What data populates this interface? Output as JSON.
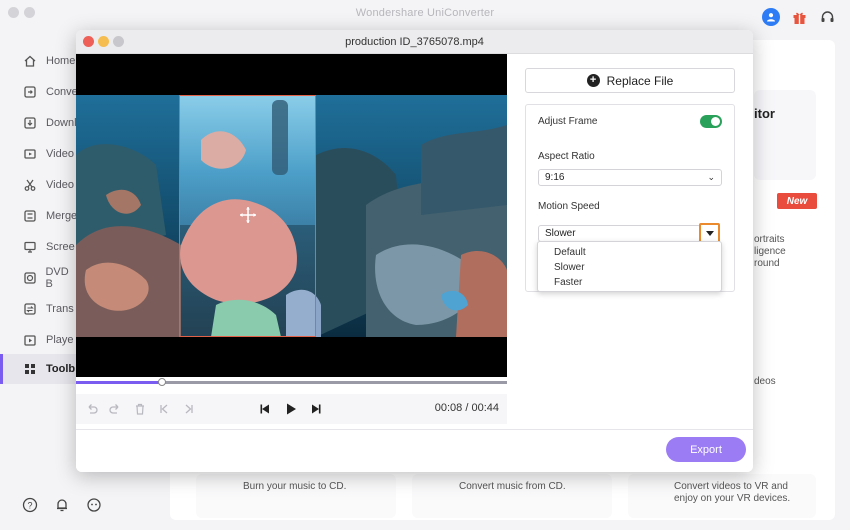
{
  "app": {
    "title": "Wondershare UniConverter"
  },
  "sidebar": {
    "items": [
      {
        "label": "Home",
        "icon": "home-icon"
      },
      {
        "label": "Conve",
        "icon": "convert-icon"
      },
      {
        "label": "Downl",
        "icon": "download-icon"
      },
      {
        "label": "Video",
        "icon": "video-compress-icon"
      },
      {
        "label": "Video",
        "icon": "scissors-icon"
      },
      {
        "label": "Merge",
        "icon": "merge-icon"
      },
      {
        "label": "Scree",
        "icon": "screen-record-icon"
      },
      {
        "label": "DVD B",
        "icon": "dvd-icon"
      },
      {
        "label": "Trans",
        "icon": "transfer-icon"
      },
      {
        "label": "Playe",
        "icon": "player-icon"
      },
      {
        "label": "Toolb",
        "icon": "toolbox-icon"
      }
    ],
    "active_index": 10
  },
  "background": {
    "itor_text": "itor",
    "new_badge": "New",
    "ai_portrait_text": "ortraits\nligence\nround",
    "videos_text": "deos",
    "burn_cd_text": "Burn your music to CD.",
    "cd_convert_text": "Convert music from CD.",
    "vr_text": "Convert videos to VR and\nenjoy on your VR devices."
  },
  "dialog": {
    "title": "production ID_3765078.mp4",
    "time_current": "00:08",
    "time_separator": "/",
    "time_total": "00:44",
    "progress_fraction": 0.2,
    "replace_label": "Replace File",
    "adjust_frame_label": "Adjust Frame",
    "adjust_frame_on": true,
    "aspect_ratio_label": "Aspect Ratio",
    "aspect_ratio_value": "9:16",
    "motion_speed_label": "Motion Speed",
    "motion_speed_value": "Slower",
    "motion_speed_options": [
      "Default",
      "Slower",
      "Faster"
    ],
    "export_label": "Export"
  },
  "colors": {
    "accent": "#7b5cf0",
    "export": "#9c7cf5",
    "toggle_on": "#2aa15b",
    "highlight": "#ea8a2d",
    "crop_border": "#e06048",
    "new_badge": "#e94b3c"
  }
}
